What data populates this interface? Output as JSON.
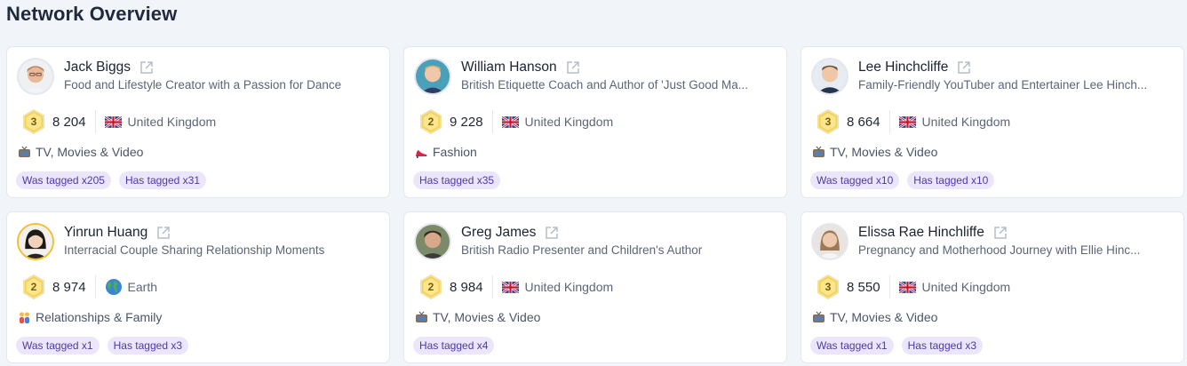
{
  "page": {
    "title": "Network Overview"
  },
  "colors": {
    "background": "#f1f4f9",
    "tag_bg": "#ebe6fb",
    "tag_text": "#4b3aa8",
    "medal_gold": "#f6d04d"
  },
  "cards": [
    {
      "name": "Jack Biggs",
      "description": "Food and Lifestyle Creator with a Passion for Dance",
      "rank": "3",
      "followers": "8 204",
      "country": "United Kingdom",
      "country_icon": "uk-flag-icon",
      "category": "TV, Movies & Video",
      "category_icon": "tv-icon",
      "tags": [
        "Was tagged x205",
        "Has tagged x31"
      ]
    },
    {
      "name": "William Hanson",
      "description": "British Etiquette Coach and Author of 'Just Good Ma...",
      "rank": "2",
      "followers": "9 228",
      "country": "United Kingdom",
      "country_icon": "uk-flag-icon",
      "category": "Fashion",
      "category_icon": "high-heel-icon",
      "tags": [
        "Has tagged x35"
      ]
    },
    {
      "name": "Lee Hinchcliffe",
      "description": "Family-Friendly YouTuber and Entertainer Lee Hinch...",
      "rank": "3",
      "followers": "8 664",
      "country": "United Kingdom",
      "country_icon": "uk-flag-icon",
      "category": "TV, Movies & Video",
      "category_icon": "tv-icon",
      "tags": [
        "Was tagged x10",
        "Has tagged x10"
      ]
    },
    {
      "name": "Yinrun Huang",
      "description": "Interracial Couple Sharing Relationship Moments",
      "rank": "2",
      "followers": "8 974",
      "country": "Earth",
      "country_icon": "globe-icon",
      "category": "Relationships & Family",
      "category_icon": "couple-icon",
      "tags": [
        "Was tagged x1",
        "Has tagged x3"
      ]
    },
    {
      "name": "Greg James",
      "description": "British Radio Presenter and Children's Author",
      "rank": "2",
      "followers": "8 984",
      "country": "United Kingdom",
      "country_icon": "uk-flag-icon",
      "category": "TV, Movies & Video",
      "category_icon": "tv-icon",
      "tags": [
        "Has tagged x4"
      ]
    },
    {
      "name": "Elissa Rae Hinchliffe",
      "description": "Pregnancy and Motherhood Journey with Ellie Hinc...",
      "rank": "3",
      "followers": "8 550",
      "country": "United Kingdom",
      "country_icon": "uk-flag-icon",
      "category": "TV, Movies & Video",
      "category_icon": "tv-icon",
      "tags": [
        "Was tagged x1",
        "Has tagged x3"
      ]
    }
  ]
}
